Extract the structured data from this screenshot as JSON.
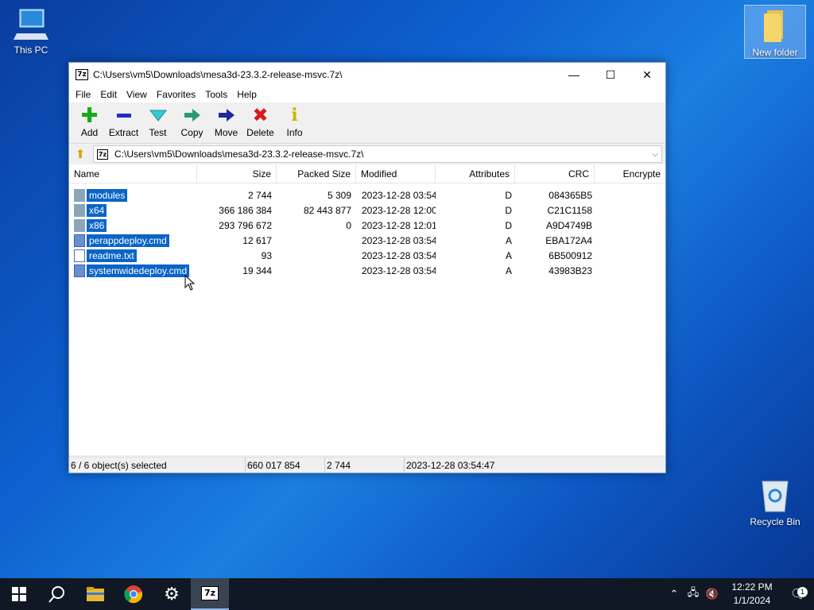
{
  "desktop": {
    "icons": [
      {
        "label": "This PC"
      },
      {
        "label": "New folder"
      },
      {
        "label": "Recycle Bin"
      }
    ]
  },
  "window": {
    "title": "C:\\Users\\vm5\\Downloads\\mesa3d-23.3.2-release-msvc.7z\\",
    "app_icon": "7z",
    "menu": [
      "File",
      "Edit",
      "View",
      "Favorites",
      "Tools",
      "Help"
    ],
    "toolbar": [
      {
        "label": "Add",
        "icon": "plus-icon",
        "color": "#1aa81a"
      },
      {
        "label": "Extract",
        "icon": "minus-icon",
        "color": "#1a2fc8"
      },
      {
        "label": "Test",
        "icon": "check-icon",
        "color": "#1ab8b8"
      },
      {
        "label": "Copy",
        "icon": "arrow-copy-icon",
        "color": "#2a8a7a"
      },
      {
        "label": "Move",
        "icon": "arrow-move-icon",
        "color": "#1a2a9a"
      },
      {
        "label": "Delete",
        "icon": "x-icon",
        "color": "#d81a1a"
      },
      {
        "label": "Info",
        "icon": "info-icon",
        "color": "#c8b800"
      }
    ],
    "address": "C:\\Users\\vm5\\Downloads\\mesa3d-23.3.2-release-msvc.7z\\",
    "columns": [
      "Name",
      "Size",
      "Packed Size",
      "Modified",
      "Attributes",
      "CRC",
      "Encrypte"
    ],
    "files": [
      {
        "name": "modules",
        "type": "folder",
        "size": "2 744",
        "packed": "5 309",
        "modified": "2023-12-28 03:54",
        "attr": "D",
        "crc": "084365B5"
      },
      {
        "name": "x64",
        "type": "folder",
        "size": "366 186 384",
        "packed": "82 443 877",
        "modified": "2023-12-28 12:00",
        "attr": "D",
        "crc": "C21C1158"
      },
      {
        "name": "x86",
        "type": "folder",
        "size": "293 796 672",
        "packed": "0",
        "modified": "2023-12-28 12:01",
        "attr": "D",
        "crc": "A9D4749B"
      },
      {
        "name": "perappdeploy.cmd",
        "type": "cmd",
        "size": "12 617",
        "packed": "",
        "modified": "2023-12-28 03:54",
        "attr": "A",
        "crc": "EBA172A4"
      },
      {
        "name": "readme.txt",
        "type": "txt",
        "size": "93",
        "packed": "",
        "modified": "2023-12-28 03:54",
        "attr": "A",
        "crc": "6B500912"
      },
      {
        "name": "systemwidedeploy.cmd",
        "type": "cmd",
        "size": "19 344",
        "packed": "",
        "modified": "2023-12-28 03:54",
        "attr": "A",
        "crc": "43983B23"
      }
    ],
    "status": {
      "selected": "6 / 6 object(s) selected",
      "total_size": "660 017 854",
      "size2": "2 744",
      "modified": "2023-12-28 03:54:47"
    }
  },
  "taskbar": {
    "clock_time": "12:22 PM",
    "clock_date": "1/1/2024",
    "notification_count": "1"
  },
  "colors": {
    "selection": "#0a64c8",
    "taskbar": "#101825"
  }
}
